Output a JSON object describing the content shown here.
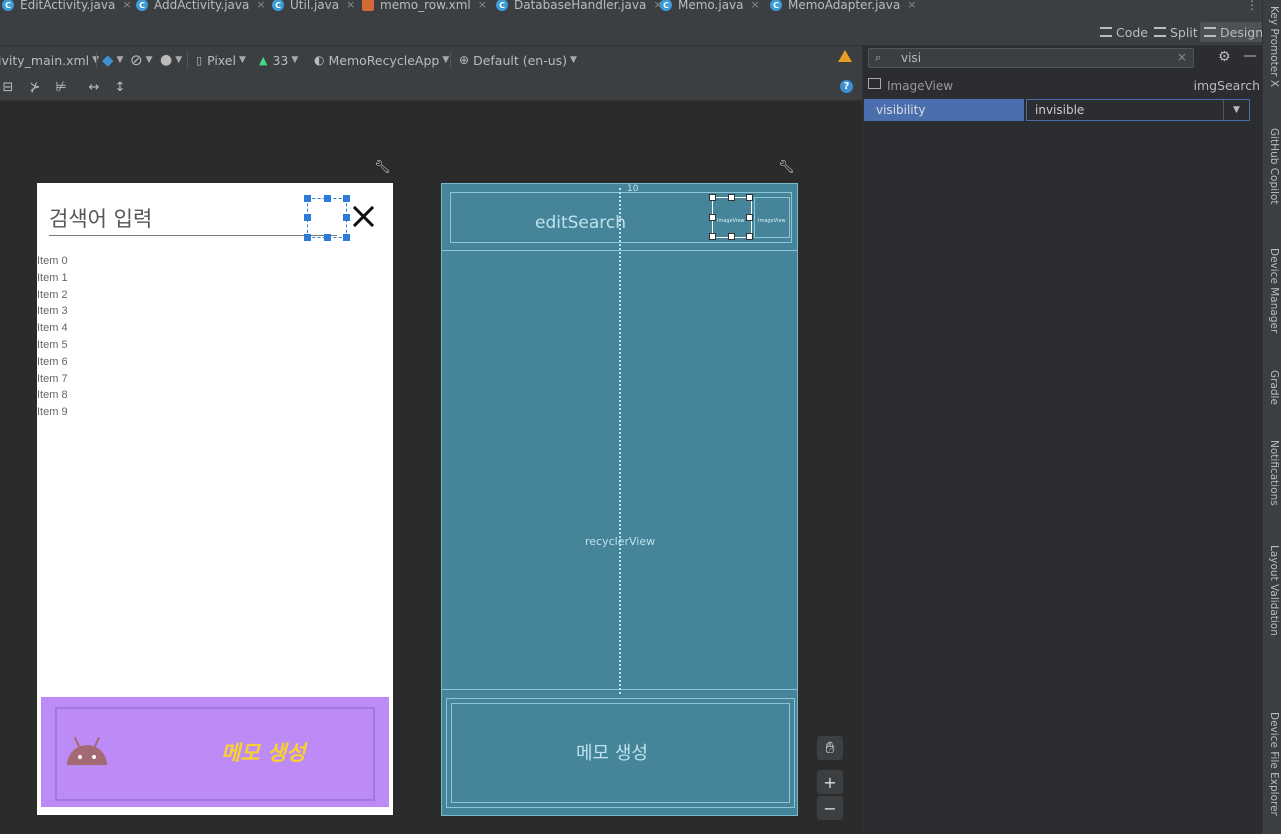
{
  "tabs": [
    {
      "label": "EditActivity.java",
      "kind": "java"
    },
    {
      "label": "AddActivity.java",
      "kind": "java"
    },
    {
      "label": "Util.java",
      "kind": "java"
    },
    {
      "label": "memo_row.xml",
      "kind": "xml"
    },
    {
      "label": "DatabaseHandler.java",
      "kind": "java"
    },
    {
      "label": "Memo.java",
      "kind": "java"
    },
    {
      "label": "MemoAdapter.java",
      "kind": "java"
    }
  ],
  "modes": {
    "code": "Code",
    "split": "Split",
    "design": "Design"
  },
  "toolbar": {
    "file": "ivity_main.xml",
    "device": "Pixel",
    "api": "33",
    "theme": "MemoRecycleApp",
    "locale": "Default (en-us)"
  },
  "attributes": {
    "search_value": "visi",
    "component_type": "ImageView",
    "component_id": "imgSearch",
    "attr_name": "visibility",
    "attr_value": "invisible"
  },
  "design": {
    "search_hint": "검색어 입력",
    "items": [
      "Item 0",
      "Item 1",
      "Item 2",
      "Item 3",
      "Item 4",
      "Item 5",
      "Item 6",
      "Item 7",
      "Item 8",
      "Item 9"
    ],
    "memo_button": "메모 생성"
  },
  "blueprint": {
    "edit_label": "editSearch",
    "image_label": "ImageView",
    "recycler_label": "recyclerView",
    "margin_label": "10",
    "button_label": "메모 생성"
  },
  "zoom": {
    "plus": "+",
    "minus": "−"
  },
  "right_strip": [
    "Key Promoter X",
    "GitHub Copilot",
    "Device Manager",
    "Gradle",
    "Notifications",
    "Layout Validation",
    "Device File Explorer"
  ],
  "colors": {
    "accent": "#4b6eaf",
    "selection": "#2e7bd8",
    "blueprint": "#46849a",
    "button": "#bd8bf5",
    "button_text": "#f8d130"
  }
}
